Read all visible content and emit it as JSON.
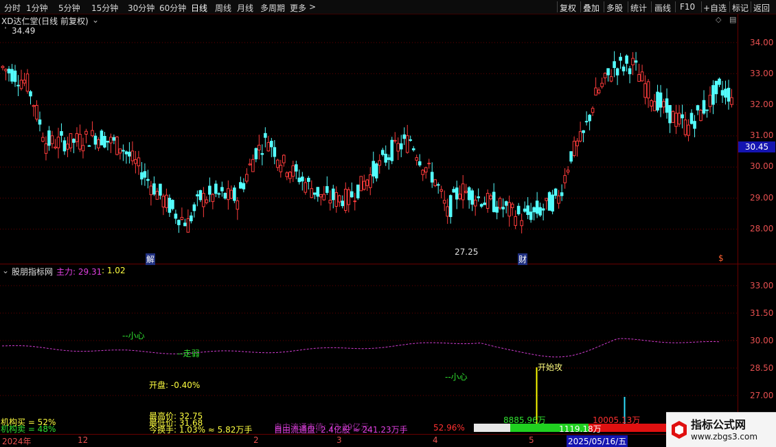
{
  "toolbar": {
    "periods": [
      "分时",
      "1分钟",
      "5分钟",
      "15分钟",
      "30分钟",
      "60分钟",
      "日线",
      "周线",
      "月线",
      "多周期",
      "更多"
    ],
    "active_period": "日线",
    "more_arrow": ">",
    "actions": [
      "复权",
      "叠加",
      "多股",
      "统计",
      "画线",
      "F10",
      "+自选",
      "标记",
      "返回"
    ]
  },
  "main_panel": {
    "title": "XD达仁堂(日线 前复权)",
    "high_label": "34.49",
    "low_label": "27.25",
    "current_price": "30.45",
    "y_axis": [
      "34.00",
      "33.00",
      "32.00",
      "31.00",
      "30.00",
      "29.00",
      "28.00"
    ],
    "markers": [
      "解",
      "财",
      "$"
    ]
  },
  "indicator_panel": {
    "title": "股朋指标网",
    "main_label": "主力: 29.31",
    "main_value2": "1.02",
    "y_axis": [
      "33.00",
      "31.50",
      "30.00",
      "28.50",
      "27.00"
    ],
    "annotations": {
      "caution1": "--小心",
      "weak": "--走弱",
      "caution2": "--小心",
      "start_attack": "开始攻"
    },
    "open_pct": "开盘: -0.40%",
    "highest": "最高价: 32.75",
    "lowest": "最低价: 31.68",
    "turnover": "今换手: 1.03% ≈ 5.82万手",
    "inst_buy": "机构买 = 52%",
    "inst_sell": "机构卖 = 48%",
    "float_cap": "自由流通盘: 2.4亿股 ≈ 241.23万手",
    "float_value": "自由流通市值: 73.29亿元",
    "pct_red": "52.96%",
    "vol_green": "8885.96万",
    "vol_red": "10005.13万",
    "bar_mid": "1119.18万",
    "date_box": "2025/05/16/五"
  },
  "x_axis": [
    "2024年",
    "12",
    "2",
    "3",
    "4",
    "5"
  ],
  "watermark": {
    "title": "指标公式网",
    "url": "www.zbgs3.com"
  },
  "colors": {
    "up": "#ff3c3c",
    "down": "#54ffff",
    "grid": "#6a0000",
    "line_magenta": "#d23cd2",
    "yellow": "#ffff00",
    "green": "#30e030"
  }
}
